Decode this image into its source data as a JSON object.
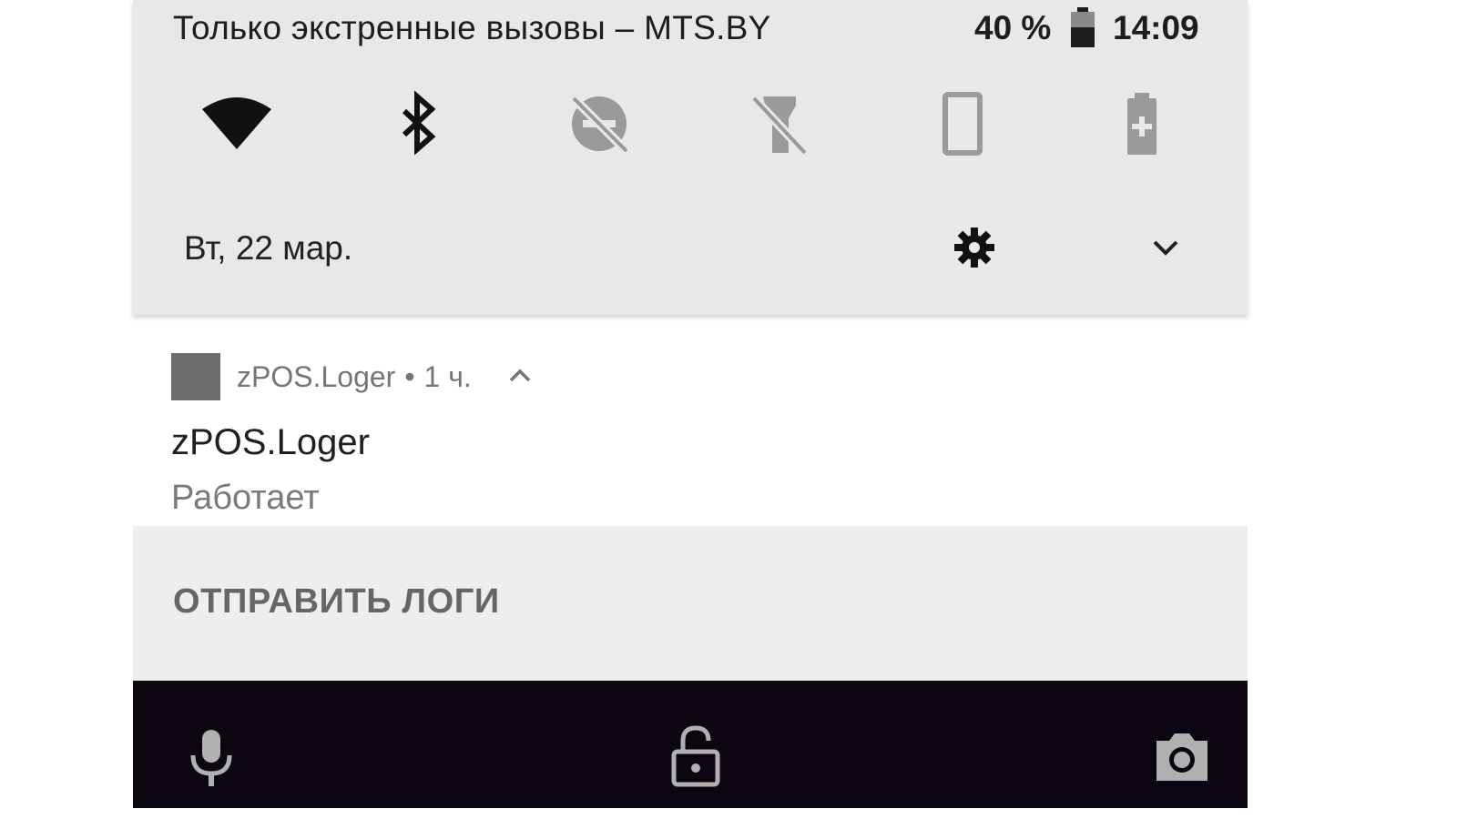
{
  "status_bar": {
    "carrier_text": "Только экстренные вызовы – MTS.BY",
    "battery_percent": "40 %",
    "time": "14:09",
    "battery_icon": "battery-icon"
  },
  "quick_settings": {
    "tiles": [
      {
        "icon": "wifi-icon",
        "enabled": true
      },
      {
        "icon": "bluetooth-icon",
        "enabled": true
      },
      {
        "icon": "do-not-disturb-off-icon",
        "enabled": false
      },
      {
        "icon": "flashlight-off-icon",
        "enabled": false
      },
      {
        "icon": "auto-rotate-icon",
        "enabled": false
      },
      {
        "icon": "battery-saver-icon",
        "enabled": false
      }
    ],
    "date": "Вт, 22 мар.",
    "settings_icon": "gear-icon",
    "expand_icon": "chevron-down-icon"
  },
  "notification": {
    "app_name": "zPOS.Loger",
    "separator": "•",
    "time_ago": "1 ч.",
    "title": "zPOS.Loger",
    "text": "Работает",
    "action_label": "ОТПРАВИТЬ ЛОГИ"
  },
  "lock_bar": {
    "icons": [
      "microphone-icon",
      "lock-icon",
      "camera-icon"
    ]
  },
  "colors": {
    "shade_bg": "#e8e8e8",
    "action_bg": "#eeeeee",
    "lock_bar_bg": "#0b0610",
    "dimmed_icon": "#9a9a9a"
  }
}
